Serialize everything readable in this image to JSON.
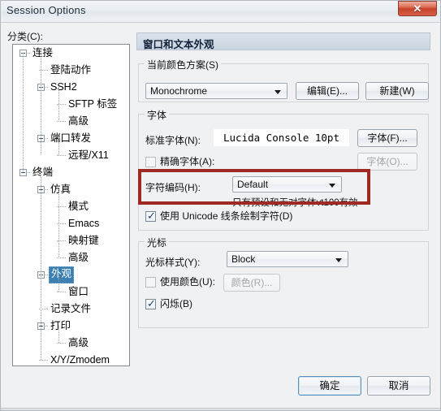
{
  "window": {
    "title": "Session Options",
    "close_icon": "close-icon",
    "close_glyph": "✕"
  },
  "sidebar": {
    "label": "分类(C):",
    "selected": "外观",
    "items": [
      {
        "label": "连接",
        "depth": 0,
        "expander": "collapse",
        "selected": false
      },
      {
        "label": "登陆动作",
        "depth": 1,
        "expander": "none",
        "selected": false
      },
      {
        "label": "SSH2",
        "depth": 1,
        "expander": "collapse",
        "selected": false
      },
      {
        "label": "SFTP 标签",
        "depth": 2,
        "expander": "none",
        "selected": false
      },
      {
        "label": "高级",
        "depth": 2,
        "expander": "none",
        "selected": false
      },
      {
        "label": "端口转发",
        "depth": 1,
        "expander": "collapse",
        "selected": false
      },
      {
        "label": "远程/X11",
        "depth": 2,
        "expander": "none",
        "selected": false
      },
      {
        "label": "终端",
        "depth": 0,
        "expander": "collapse",
        "selected": false
      },
      {
        "label": "仿真",
        "depth": 1,
        "expander": "collapse",
        "selected": false
      },
      {
        "label": "模式",
        "depth": 2,
        "expander": "none",
        "selected": false
      },
      {
        "label": "Emacs",
        "depth": 2,
        "expander": "none",
        "selected": false
      },
      {
        "label": "映射键",
        "depth": 2,
        "expander": "none",
        "selected": false
      },
      {
        "label": "高级",
        "depth": 2,
        "expander": "none",
        "selected": false
      },
      {
        "label": "外观",
        "depth": 1,
        "expander": "collapse",
        "selected": true
      },
      {
        "label": "窗口",
        "depth": 2,
        "expander": "none",
        "selected": false
      },
      {
        "label": "记录文件",
        "depth": 1,
        "expander": "none",
        "selected": false
      },
      {
        "label": "打印",
        "depth": 1,
        "expander": "collapse",
        "selected": false
      },
      {
        "label": "高级",
        "depth": 2,
        "expander": "none",
        "selected": false
      },
      {
        "label": "X/Y/Zmodem",
        "depth": 1,
        "expander": "none",
        "selected": false
      }
    ]
  },
  "pane": {
    "header": "窗口和文本外观",
    "color_scheme": {
      "group_title": "当前颜色方案(S)",
      "value": "Monochrome",
      "edit_button": "编辑(E)...",
      "new_button": "新建(W)"
    },
    "font": {
      "group_title": "字体",
      "normal_font_label": "标准字体(N):",
      "normal_font_value": "Lucida Console 10pt",
      "normal_font_button": "字体(F)...",
      "exact_font_label": "精确字体(A):",
      "exact_font_button": "字体(O)...",
      "exact_font_checked": false,
      "charset_label": "字符编码(H):",
      "charset_value": "Default",
      "charset_hint": "只有预设和无对字体vt100有效",
      "unicode_label": "使用 Unicode 线条绘制字符(D)",
      "unicode_checked": true
    },
    "cursor": {
      "group_title": "光标",
      "style_label": "光标样式(Y):",
      "style_value": "Block",
      "use_color_label": "使用颜色(U):",
      "use_color_checked": false,
      "color_button": "颜色(R)...",
      "blink_label": "闪烁(B)",
      "blink_checked": true
    }
  },
  "footer": {
    "ok_label": "确定",
    "cancel_label": "取消"
  },
  "annotation": {
    "highlight_color": "#9e2a22"
  }
}
